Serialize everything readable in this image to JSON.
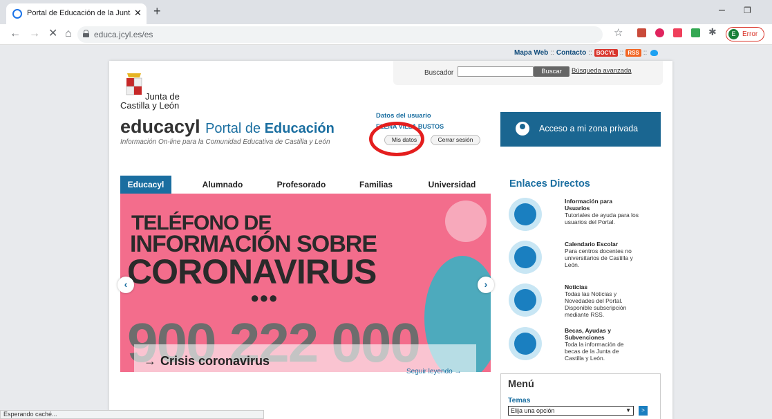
{
  "browser": {
    "tab_title": "Portal de Educación de la Junta d",
    "url": "educa.jcyl.es/es",
    "profile_initial": "E",
    "profile_status": "Error",
    "status_text": "Esperando caché..."
  },
  "toplinks": {
    "mapa": "Mapa Web",
    "sep": "::",
    "contacto": "Contacto",
    "bocyl": "BOCYL",
    "rss": "RSS"
  },
  "search": {
    "label": "Buscador",
    "button": "Buscar",
    "advanced": "Búsqueda avanzada"
  },
  "header": {
    "gov_line1": "Junta de",
    "gov_line2": "Castilla y León",
    "brand": "educacyl",
    "portal_pre": "Portal de",
    "portal_bold": "Educación",
    "tagline": "Información On-line para la Comunidad Educativa de Castilla y León"
  },
  "user": {
    "title": "Datos del usuario",
    "name": "ELENA VILLA BUSTOS",
    "mis_datos": "Mis datos",
    "cerrar": "Cerrar sesión"
  },
  "private_zone": {
    "label": "Acceso a mi zona privada"
  },
  "tabs": [
    "Educacyl",
    "Alumnado",
    "Profesorado",
    "Familias",
    "Universidad"
  ],
  "banner": {
    "line1": "TELÉFONO DE",
    "line2": "INFORMACIÓN SOBRE",
    "line3": "CORONAVIRUS",
    "phone": "900 222 000",
    "caption_arrow": "→",
    "caption": "Crisis coronavirus",
    "read_more": "Seguir leyendo →",
    "prev": "‹",
    "next": "›"
  },
  "enlaces": {
    "title": "Enlaces Directos",
    "items": [
      {
        "title": "Información para Usuarios",
        "desc": "Tutoriales de ayuda para los usuarios del Portal."
      },
      {
        "title": "Calendario Escolar",
        "desc": "Para centros docentes no universitarios de Castilla y León."
      },
      {
        "title": "Noticias",
        "desc": "Todas las Noticias y Novedades del Portal. Disponible subscripción mediante RSS."
      },
      {
        "title": "Becas, Ayudas y Subvenciones",
        "desc": "Toda la información de becas de la Junta de Castilla y León."
      }
    ]
  },
  "menu": {
    "title": "Menú",
    "temas": "Temas",
    "select": "Elija una opción",
    "go": ">"
  },
  "colors": {
    "brand_blue": "#1a6ea0",
    "private_btn": "#1a6691",
    "highlight_circle": "#e41e1e",
    "banner_pink": "#f36d8c"
  }
}
